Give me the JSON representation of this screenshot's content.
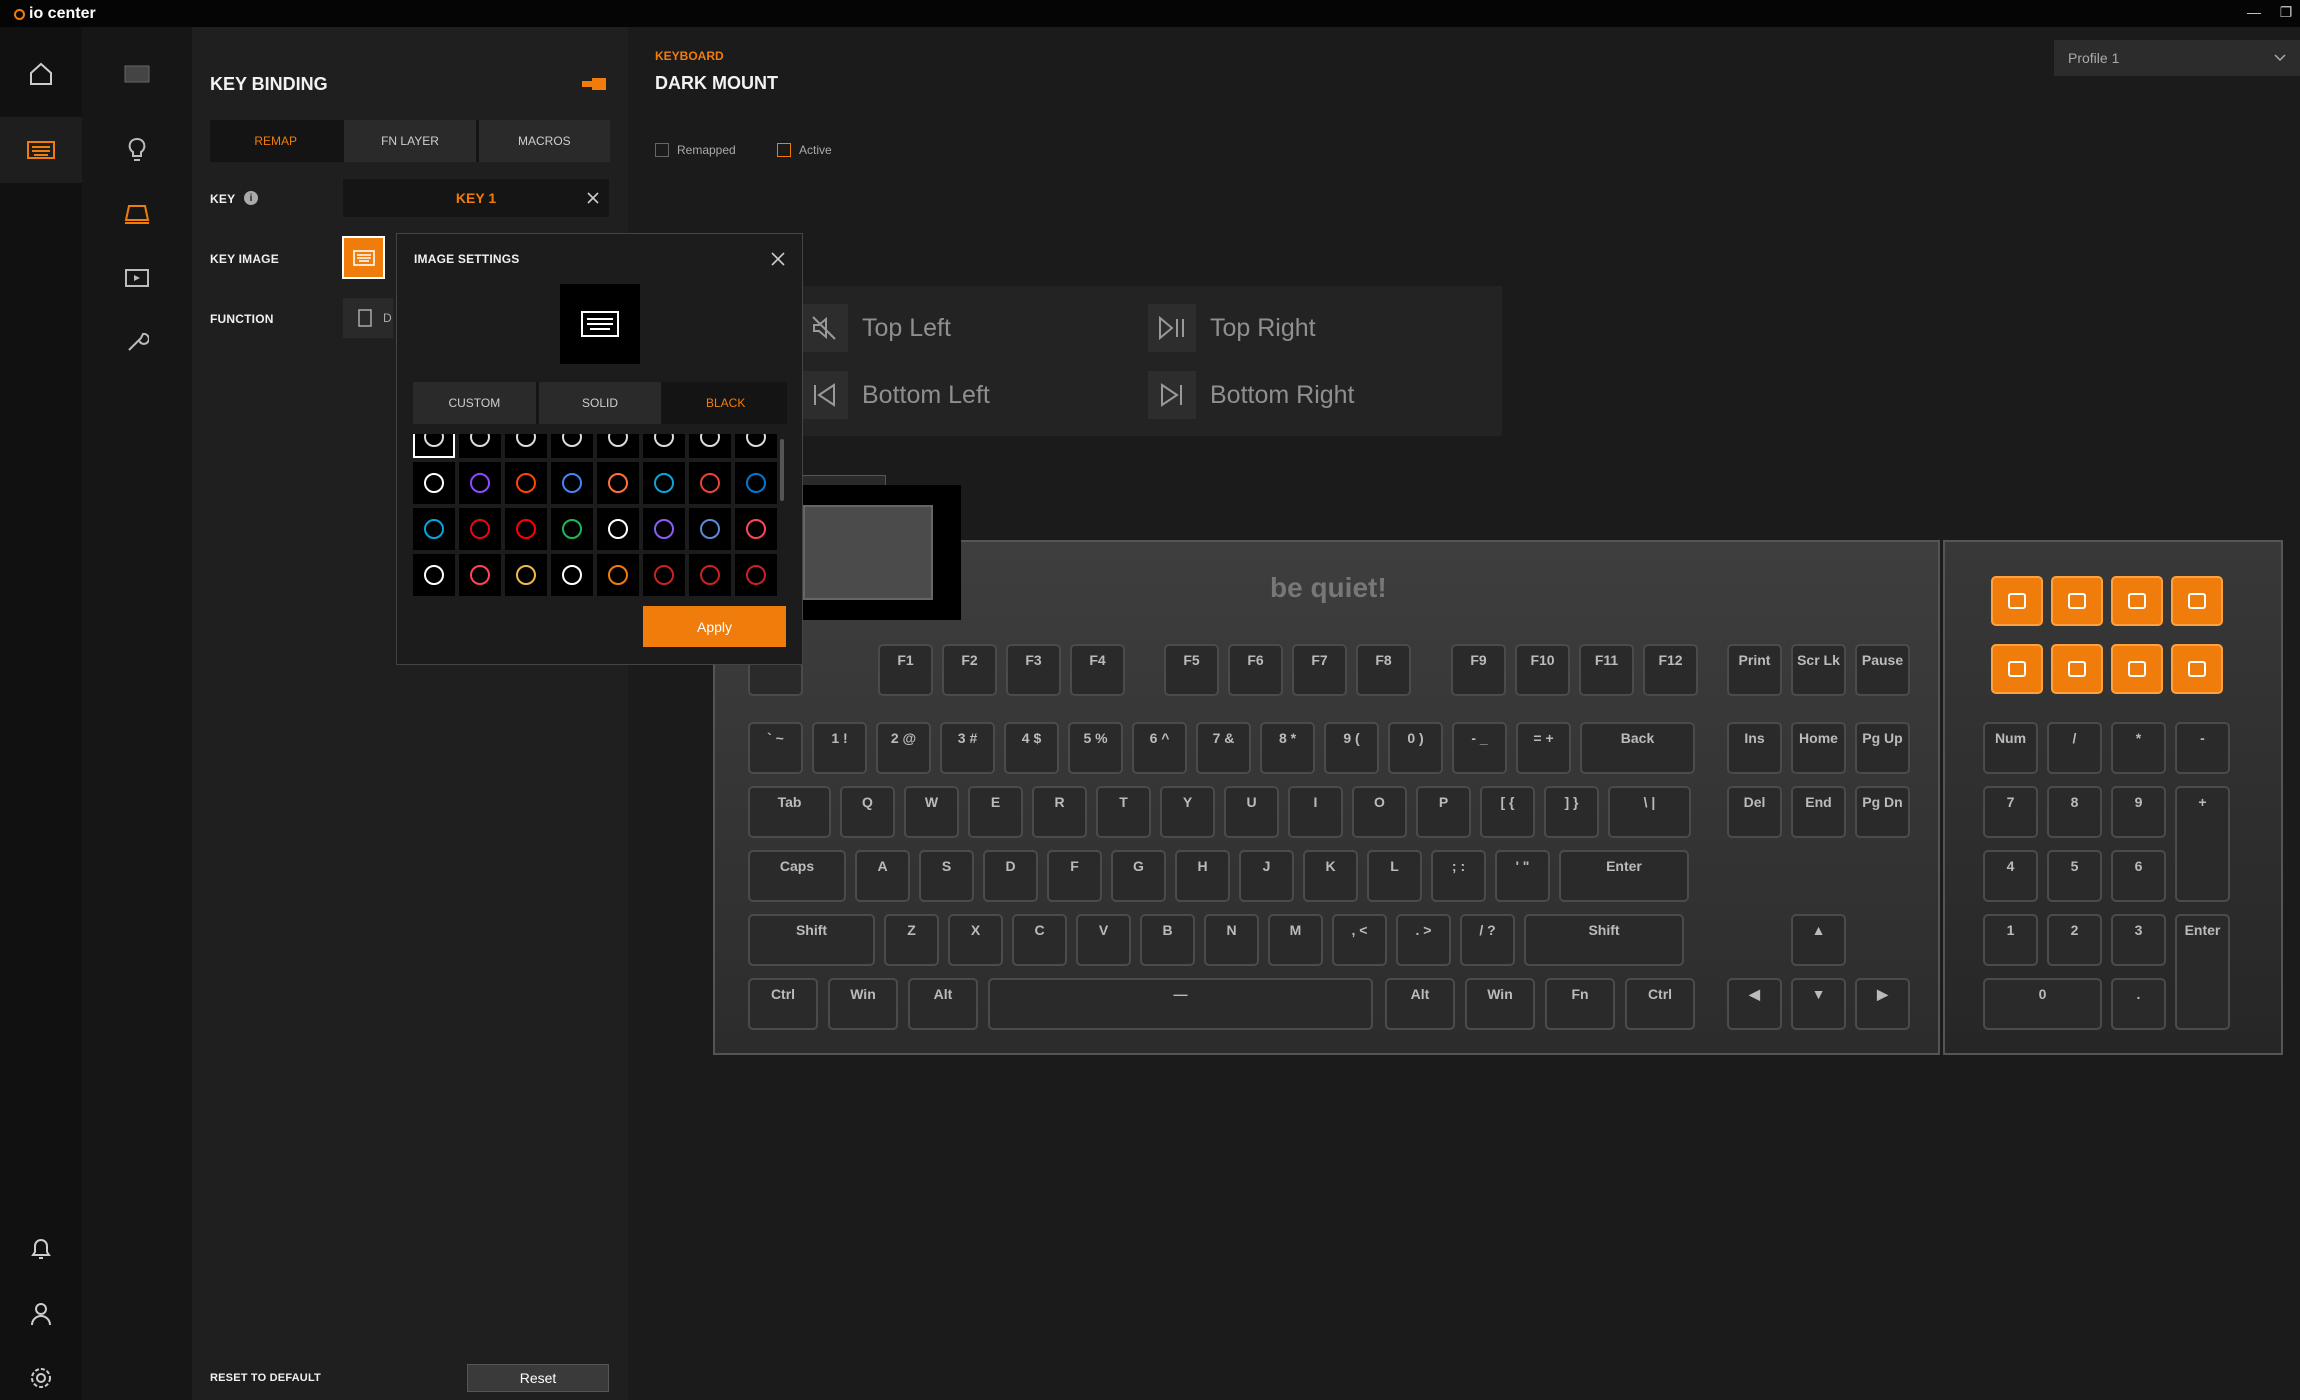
{
  "app": {
    "logo_text": "io center"
  },
  "window": {
    "minimize_glyph": "—",
    "restore_glyph": "❐"
  },
  "panel": {
    "title": "KEY BINDING",
    "tabs": [
      {
        "label": "REMAP"
      },
      {
        "label": "FN LAYER"
      },
      {
        "label": "MACROS"
      }
    ],
    "key_label": "KEY",
    "key_value": "KEY 1",
    "key_image_label": "KEY IMAGE",
    "function_label": "FUNCTION",
    "function_value": "D",
    "reset_label": "RESET TO DEFAULT",
    "reset_button": "Reset"
  },
  "dialog": {
    "title": "IMAGE SETTINGS",
    "tabs": [
      {
        "label": "CUSTOM"
      },
      {
        "label": "SOLID"
      },
      {
        "label": "BLACK"
      }
    ],
    "apply": "Apply",
    "icons_row1": [
      "keyboard-icon",
      "globe-icon",
      "folder-icon",
      "mail-icon",
      "scissors-icon",
      "pulse-icon",
      "lock-icon",
      "moon-icon"
    ],
    "icons_row2": [
      "tiktok",
      "twitch",
      "reddit",
      "chrome",
      "firefox",
      "edge",
      "gmail",
      "outlook"
    ],
    "icons_row3": [
      "prime video",
      "netflix",
      "youtube",
      "spotify",
      "x",
      "f",
      "rocket league",
      "apex"
    ],
    "icons_row4": [
      "rainbow six",
      "valorant",
      "hearthstone",
      "overwatch",
      "half-life",
      "diablo",
      "the witcher",
      "ii"
    ]
  },
  "main": {
    "category": "KEYBOARD",
    "device": "DARK MOUNT",
    "legend_remapped": "Remapped",
    "legend_active": "Active",
    "profile": "Profile 1",
    "media": {
      "top_left": "Top Left",
      "top_right": "Top Right",
      "bottom_left": "Bottom Left",
      "bottom_right": "Bottom Right"
    },
    "brand": "be quiet!"
  },
  "keyboard": {
    "frow": [
      "F1",
      "F2",
      "F3",
      "F4",
      "F5",
      "F6",
      "F7",
      "F8",
      "F9",
      "F10",
      "F11",
      "F12",
      "Print",
      "Scr Lk",
      "Pause"
    ],
    "numrow": [
      "` ~",
      "1 !",
      "2 @",
      "3 #",
      "4 $",
      "5 %",
      "6 ^",
      "7 &",
      "8 *",
      "9 (",
      "0 )",
      "- _",
      "= +",
      "Back",
      "Ins",
      "Home",
      "Pg Up"
    ],
    "qrow": [
      "Tab",
      "Q",
      "W",
      "E",
      "R",
      "T",
      "Y",
      "U",
      "I",
      "O",
      "P",
      "[ {",
      "] }",
      "\\ |",
      "Del",
      "End",
      "Pg Dn"
    ],
    "arow": [
      "Caps",
      "A",
      "S",
      "D",
      "F",
      "G",
      "H",
      "J",
      "K",
      "L",
      "; :",
      "' \"",
      "Enter"
    ],
    "zrow": [
      "Shift",
      "Z",
      "X",
      "C",
      "V",
      "B",
      "N",
      "M",
      ", <",
      ". >",
      "/ ?",
      "Shift",
      "▲"
    ],
    "brow": [
      "Ctrl",
      "Win",
      "Alt",
      "—",
      "Alt",
      "Win",
      "Fn",
      "Ctrl",
      "◀",
      "▼",
      "▶"
    ],
    "numpad": [
      "Num",
      "/",
      "*",
      "-",
      "7",
      "8",
      "9",
      "+",
      "4",
      "5",
      "6",
      "1",
      "2",
      "3",
      "Enter",
      "0",
      "."
    ]
  },
  "colors": {
    "accent": "#f07d0b",
    "background": "#1b1b1b"
  }
}
